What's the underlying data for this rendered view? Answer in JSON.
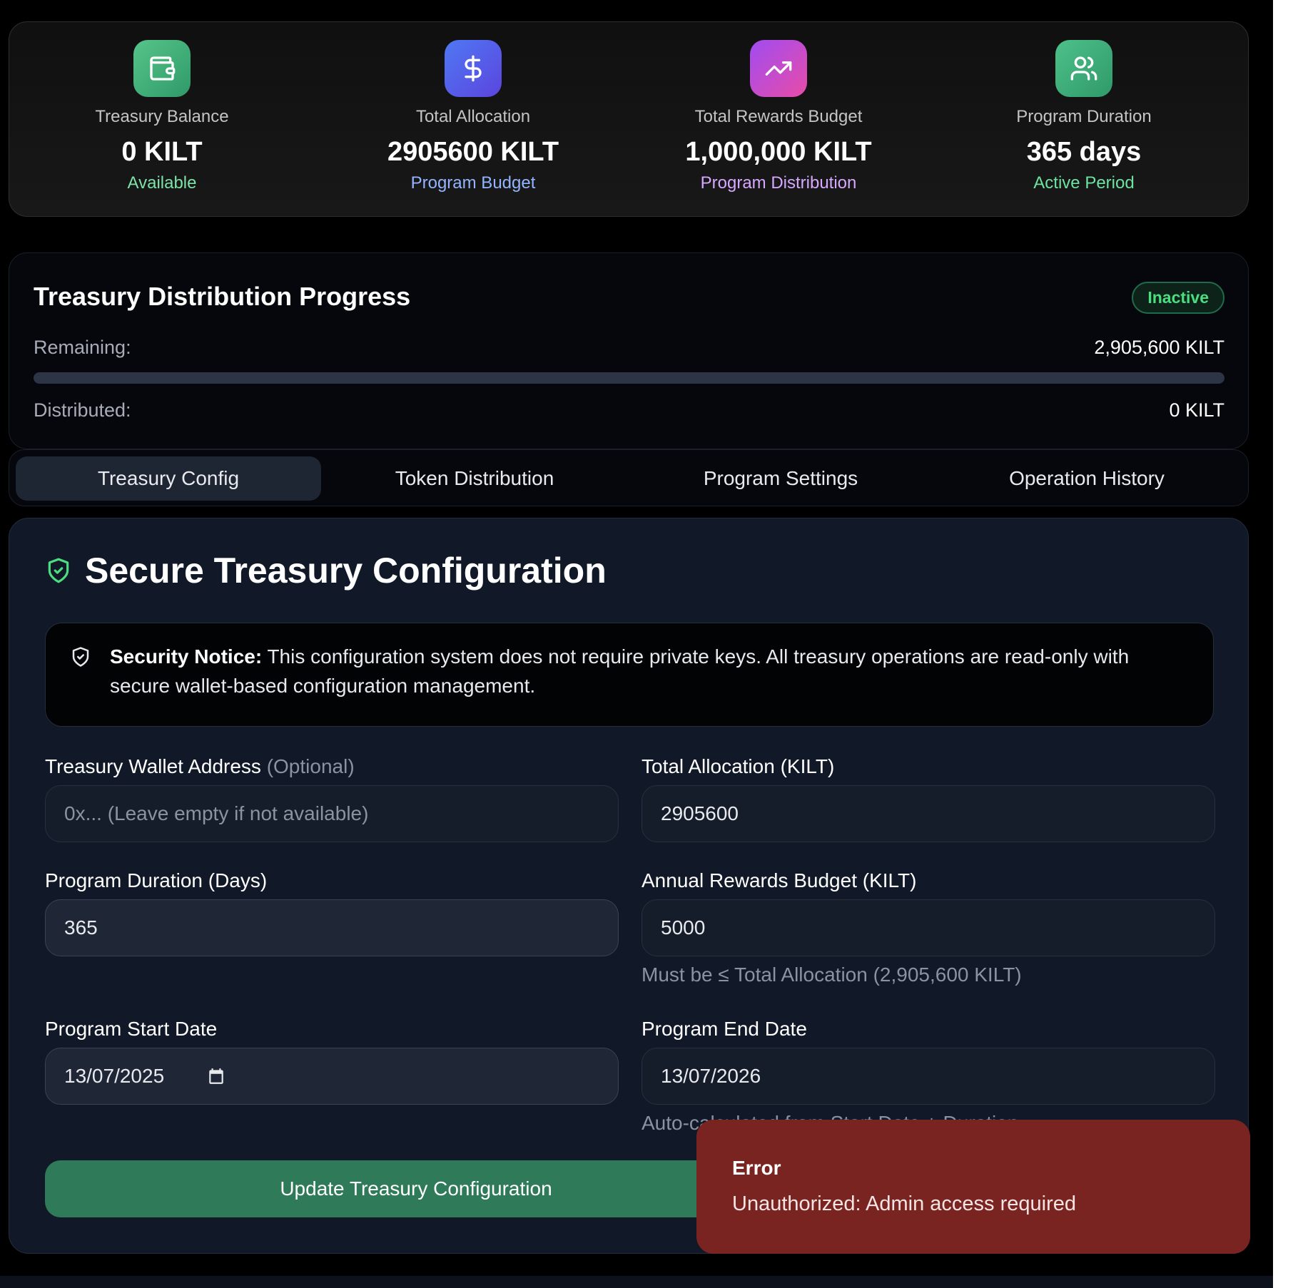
{
  "stats": [
    {
      "icon": "wallet-icon",
      "label": "Treasury Balance",
      "value": "0 KILT",
      "sub": "Available",
      "gradient": [
        "#56c48a",
        "#2f9a68"
      ],
      "sub_color": "#7ee2a8"
    },
    {
      "icon": "dollar-icon",
      "label": "Total Allocation",
      "value": "2905600 KILT",
      "sub": "Program Budget",
      "gradient": [
        "#4f78f3",
        "#5b45de"
      ],
      "sub_color": "#93b4ff"
    },
    {
      "icon": "trending-up-icon",
      "label": "Total Rewards Budget",
      "value": "1,000,000 KILT",
      "sub": "Program Distribution",
      "gradient": [
        "#a04cf1",
        "#e84ca8"
      ],
      "sub_color": "#d6a8ff"
    },
    {
      "icon": "users-icon",
      "label": "Program Duration",
      "value": "365 days",
      "sub": "Active Period",
      "gradient": [
        "#4ec08a",
        "#2f9a68"
      ],
      "sub_color": "#6ee2a0"
    }
  ],
  "progress": {
    "title": "Treasury Distribution Progress",
    "status": "Inactive",
    "remaining_label": "Remaining:",
    "remaining_value": "2,905,600 KILT",
    "distributed_label": "Distributed:",
    "distributed_value": "0 KILT",
    "fraction_distributed": 0
  },
  "tabs": [
    "Treasury Config",
    "Token Distribution",
    "Program Settings",
    "Operation History"
  ],
  "active_tab": 0,
  "config": {
    "title": "Secure Treasury Configuration",
    "notice_bold": "Security Notice:",
    "notice_text": " This configuration system does not require private keys. All treasury operations are read-only with secure wallet-based configuration management.",
    "wallet_label": "Treasury Wallet Address",
    "wallet_optional": "(Optional)",
    "wallet_placeholder": "0x... (Leave empty if not available)",
    "total_alloc_label": "Total Allocation (KILT)",
    "total_alloc_value": "2905600",
    "duration_label": "Program Duration (Days)",
    "duration_value": "365",
    "annual_label": "Annual Rewards Budget (KILT)",
    "annual_value": "5000",
    "annual_hint": "Must be ≤ Total Allocation (2,905,600 KILT)",
    "start_label": "Program Start Date",
    "start_value": "13/07/2025",
    "end_label": "Program End Date",
    "end_value": "13/07/2026",
    "end_hint": "Auto-calculated from Start Date + Duration",
    "submit_label": "Update Treasury Configuration"
  },
  "toast": {
    "title": "Error",
    "message": "Unauthorized: Admin access required"
  }
}
